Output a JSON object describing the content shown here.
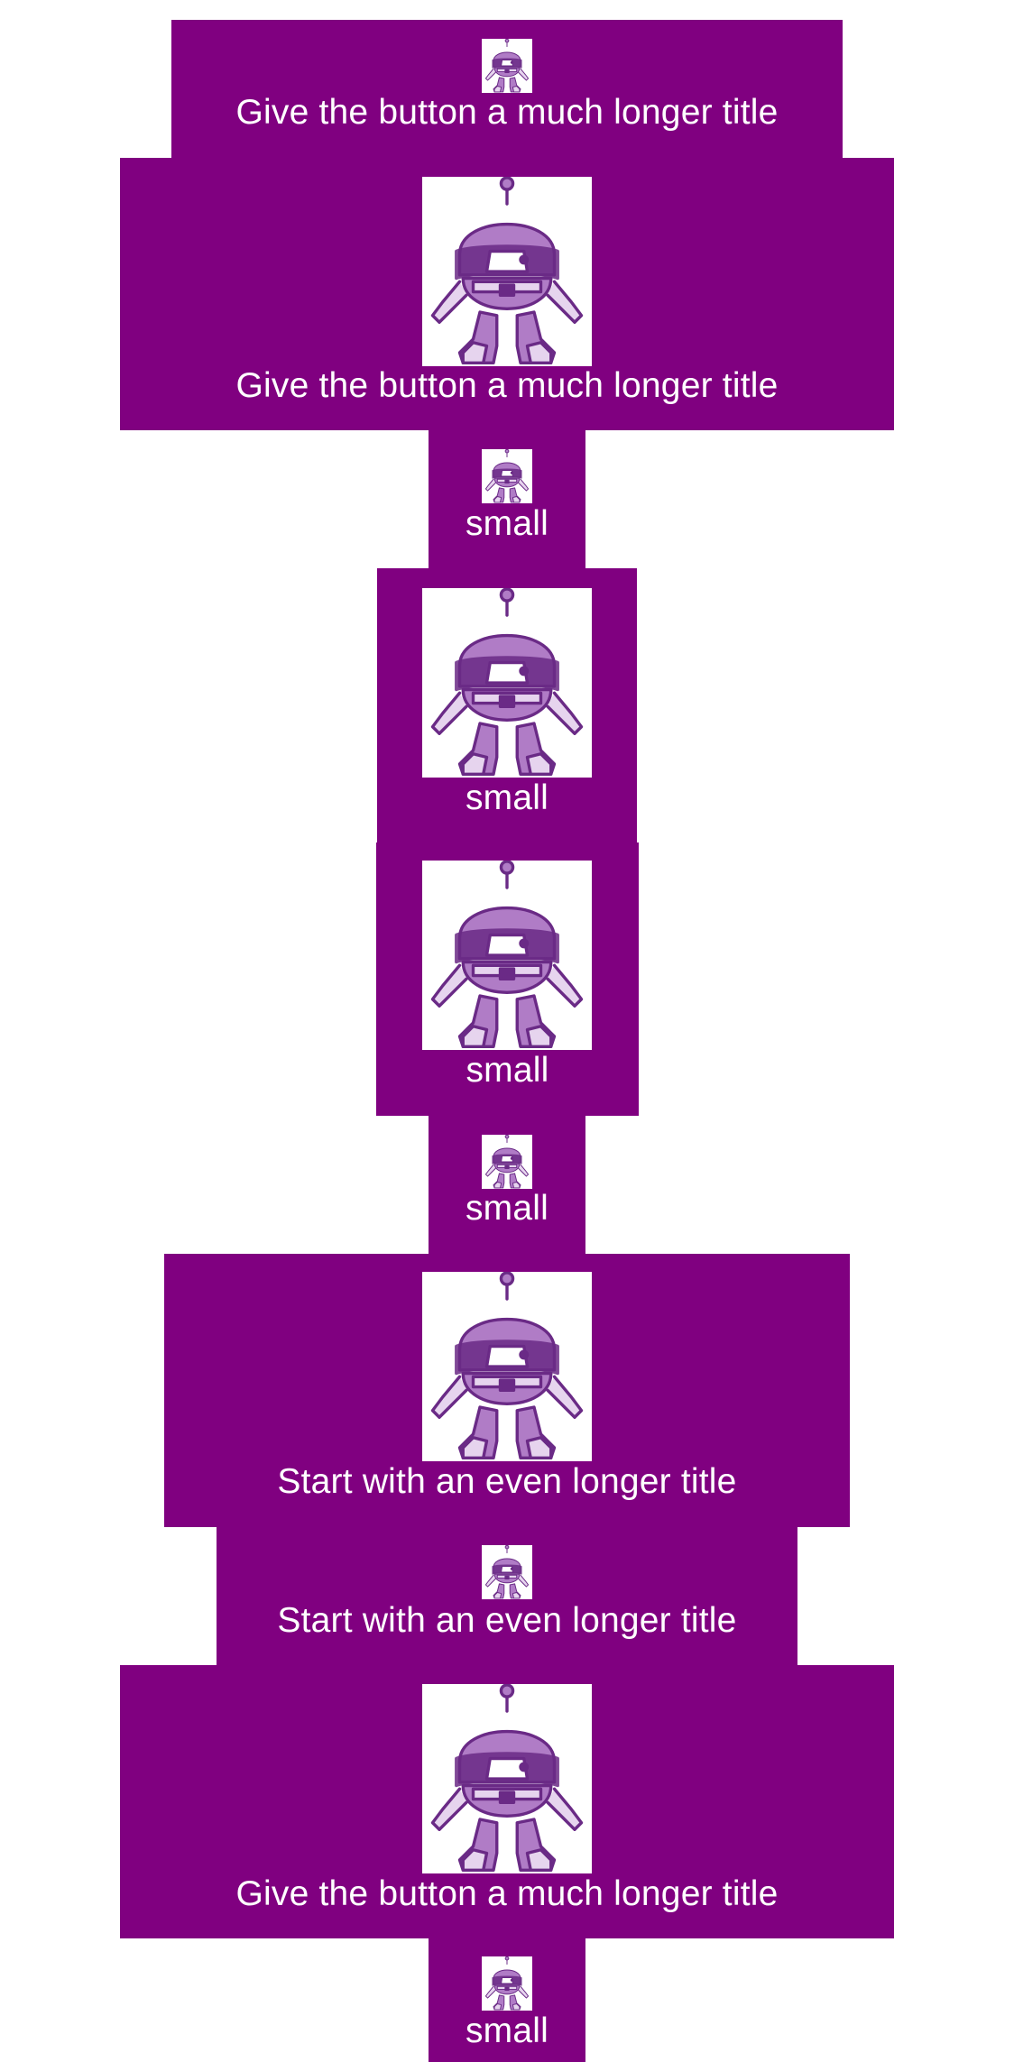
{
  "theme": {
    "button_background": "#800080",
    "button_text": "#ffffff",
    "page_background": "#ffffff",
    "robot_fill": "#b07cc6",
    "robot_light": "#e6d4ee",
    "robot_outline": "#6a2a86"
  },
  "buttons": [
    {
      "label": "Give the button a much longer title",
      "image": "robot-icon",
      "image_size": "small"
    },
    {
      "label": "Give the button a much longer title",
      "image": "robot-icon",
      "image_size": "large"
    },
    {
      "label": "small",
      "image": "robot-icon",
      "image_size": "small"
    },
    {
      "label": "small",
      "image": "robot-icon",
      "image_size": "large"
    },
    {
      "label": "small",
      "image": "robot-icon",
      "image_size": "large"
    },
    {
      "label": "small",
      "image": "robot-icon",
      "image_size": "small"
    },
    {
      "label": "Start with an even longer title",
      "image": "robot-icon",
      "image_size": "large"
    },
    {
      "label": "Start with an even longer title",
      "image": "robot-icon",
      "image_size": "small"
    },
    {
      "label": "Give the button a much longer title",
      "image": "robot-icon",
      "image_size": "large"
    },
    {
      "label": "small",
      "image": "robot-icon",
      "image_size": "small"
    }
  ]
}
